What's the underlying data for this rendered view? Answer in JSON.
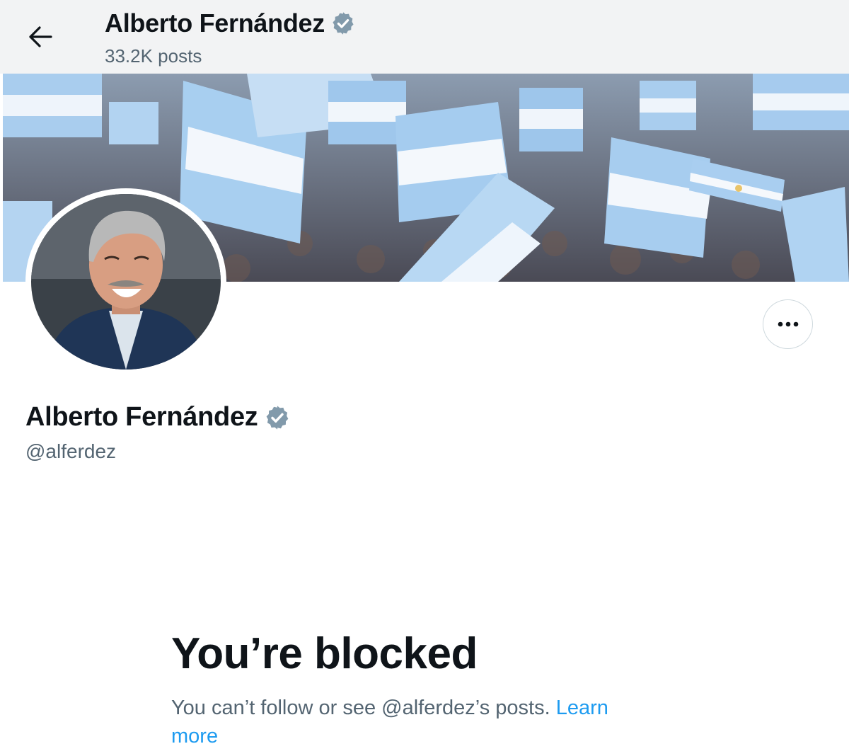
{
  "header": {
    "name": "Alberto Fernández",
    "posts": "33.2K posts",
    "back_icon": "arrow-left-icon",
    "verified_icon": "verified-badge-icon"
  },
  "profile": {
    "name": "Alberto Fernández",
    "handle": "@alferdez",
    "more_icon": "more-horizontal-icon"
  },
  "blocked": {
    "title": "You’re blocked",
    "message": "You can’t follow or see @alferdez’s posts.",
    "learn_more": "Learn more"
  },
  "colors": {
    "accent": "#1d9bf0",
    "secondary_text": "#536471",
    "badge": "#829aab",
    "header_bg": "#f2f3f4"
  }
}
